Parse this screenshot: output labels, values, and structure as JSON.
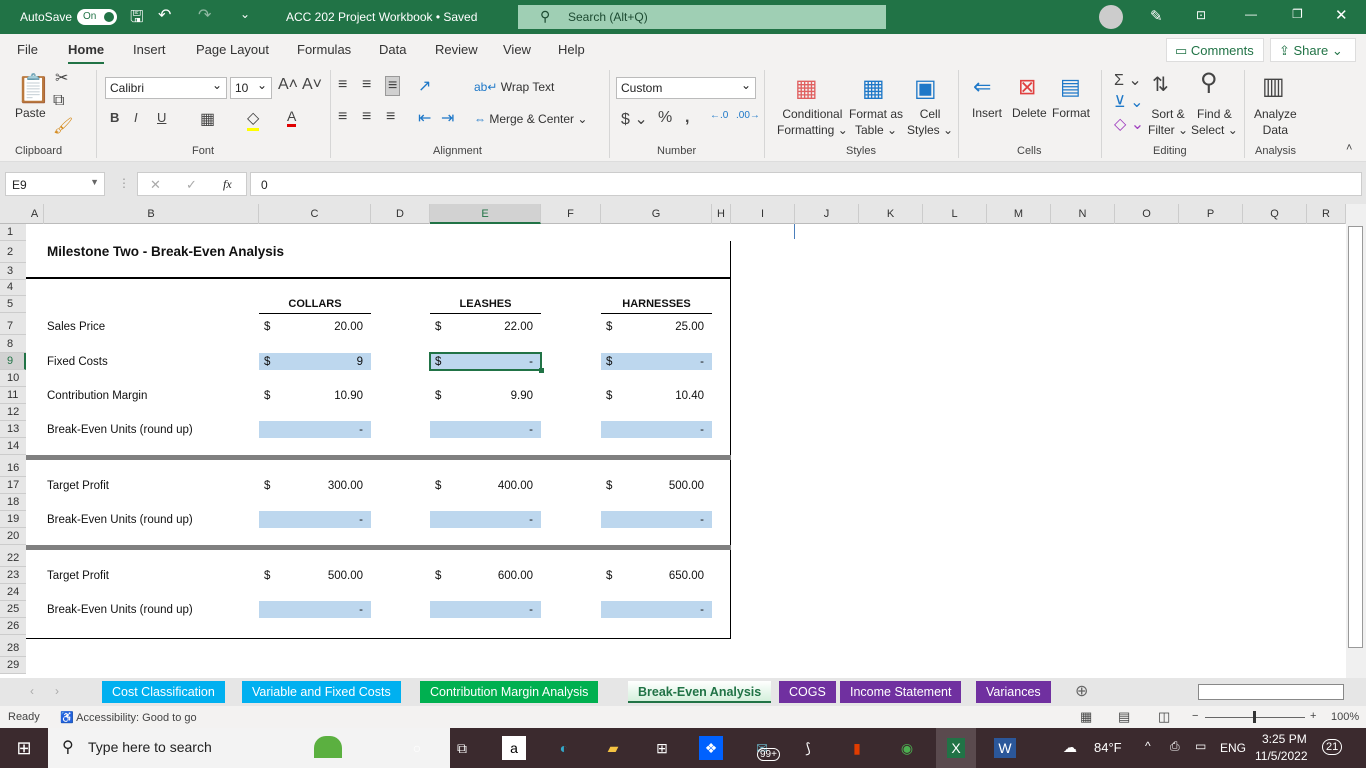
{
  "titlebar": {
    "autosave_label": "AutoSave",
    "autosave_state": "On",
    "doc_title": "ACC 202 Project Workbook • Saved",
    "search_placeholder": "Search (Alt+Q)"
  },
  "menu": {
    "items": [
      "File",
      "Home",
      "Insert",
      "Page Layout",
      "Formulas",
      "Data",
      "Review",
      "View",
      "Help"
    ],
    "active": "Home",
    "comments": "Comments",
    "share": "Share"
  },
  "ribbon": {
    "paste": "Paste",
    "font_name": "Calibri",
    "font_size": "10",
    "wrap_text": "Wrap Text",
    "merge_center": "Merge & Center",
    "number_format": "Custom",
    "conditional_formatting": [
      "Conditional",
      "Formatting"
    ],
    "format_as_table": [
      "Format as",
      "Table"
    ],
    "cell_styles": [
      "Cell",
      "Styles"
    ],
    "insert": "Insert",
    "delete": "Delete",
    "format": "Format",
    "sort_filter": [
      "Sort &",
      "Filter"
    ],
    "find_select": [
      "Find &",
      "Select"
    ],
    "analyze_data": [
      "Analyze",
      "Data"
    ],
    "groups": [
      "Clipboard",
      "Font",
      "Alignment",
      "Number",
      "Styles",
      "Cells",
      "Editing",
      "Analysis"
    ]
  },
  "formula_bar": {
    "name_box": "E9",
    "fx": "fx",
    "value": "0"
  },
  "grid": {
    "columns": [
      "A",
      "B",
      "C",
      "D",
      "E",
      "F",
      "G",
      "H",
      "I",
      "J",
      "K",
      "L",
      "M",
      "N",
      "O",
      "P",
      "Q",
      "R"
    ],
    "rows": [
      "1",
      "2",
      "3",
      "4",
      "5",
      "7",
      "8",
      "9",
      "10",
      "11",
      "12",
      "13",
      "14",
      "16",
      "17",
      "18",
      "19",
      "20",
      "22",
      "23",
      "24",
      "25",
      "26",
      "28",
      "29"
    ],
    "selected_column": "E",
    "selected_row": "9"
  },
  "sheet": {
    "title": "Milestone Two - Break-Even Analysis",
    "headers": [
      "COLLARS",
      "LEASHES",
      "HARNESSES"
    ],
    "currency": "$",
    "rows": [
      {
        "row": "7",
        "label": "Sales Price",
        "dollar": true,
        "highlight": false,
        "values": [
          "20.00",
          "22.00",
          "25.00"
        ]
      },
      {
        "row": "9",
        "label": "Fixed Costs",
        "dollar": true,
        "highlight": true,
        "values": [
          "9",
          "-",
          "-"
        ]
      },
      {
        "row": "11",
        "label": "Contribution Margin",
        "dollar": true,
        "highlight": false,
        "values": [
          "10.90",
          "9.90",
          "10.40"
        ]
      },
      {
        "row": "13",
        "label": "Break-Even Units (round up)",
        "dollar": false,
        "highlight": true,
        "values": [
          "-",
          "-",
          "-"
        ]
      },
      {
        "row": "17",
        "label": "Target Profit",
        "dollar": true,
        "highlight": false,
        "values": [
          "300.00",
          "400.00",
          "500.00"
        ]
      },
      {
        "row": "19",
        "label": "Break-Even Units (round up)",
        "dollar": false,
        "highlight": true,
        "values": [
          "-",
          "-",
          "-"
        ]
      },
      {
        "row": "23",
        "label": "Target Profit",
        "dollar": true,
        "highlight": false,
        "values": [
          "500.00",
          "600.00",
          "650.00"
        ]
      },
      {
        "row": "25",
        "label": "Break-Even Units (round up)",
        "dollar": false,
        "highlight": true,
        "values": [
          "-",
          "-",
          "-"
        ]
      }
    ],
    "highlight_color": "#bdd7ee"
  },
  "tabs": [
    {
      "label": "Cost Classification",
      "color": "#00b0f0"
    },
    {
      "label": "Variable and Fixed Costs",
      "color": "#00b0f0"
    },
    {
      "label": "Contribution Margin Analysis",
      "color": "#00b050"
    },
    {
      "label": "Break-Even Analysis",
      "color": "#00b050",
      "active": true
    },
    {
      "label": "COGS",
      "color": "#7030a0"
    },
    {
      "label": "Income Statement",
      "color": "#7030a0"
    },
    {
      "label": "Variances",
      "color": "#7030a0"
    }
  ],
  "status": {
    "ready": "Ready",
    "accessibility": "Accessibility: Good to go",
    "zoom": "100%"
  },
  "taskbar": {
    "search_placeholder": "Type here to search",
    "weather": "84°F",
    "language": "ENG",
    "time": "3:25 PM",
    "date": "11/5/2022",
    "notifications": "21",
    "mail_badge": "99+"
  }
}
